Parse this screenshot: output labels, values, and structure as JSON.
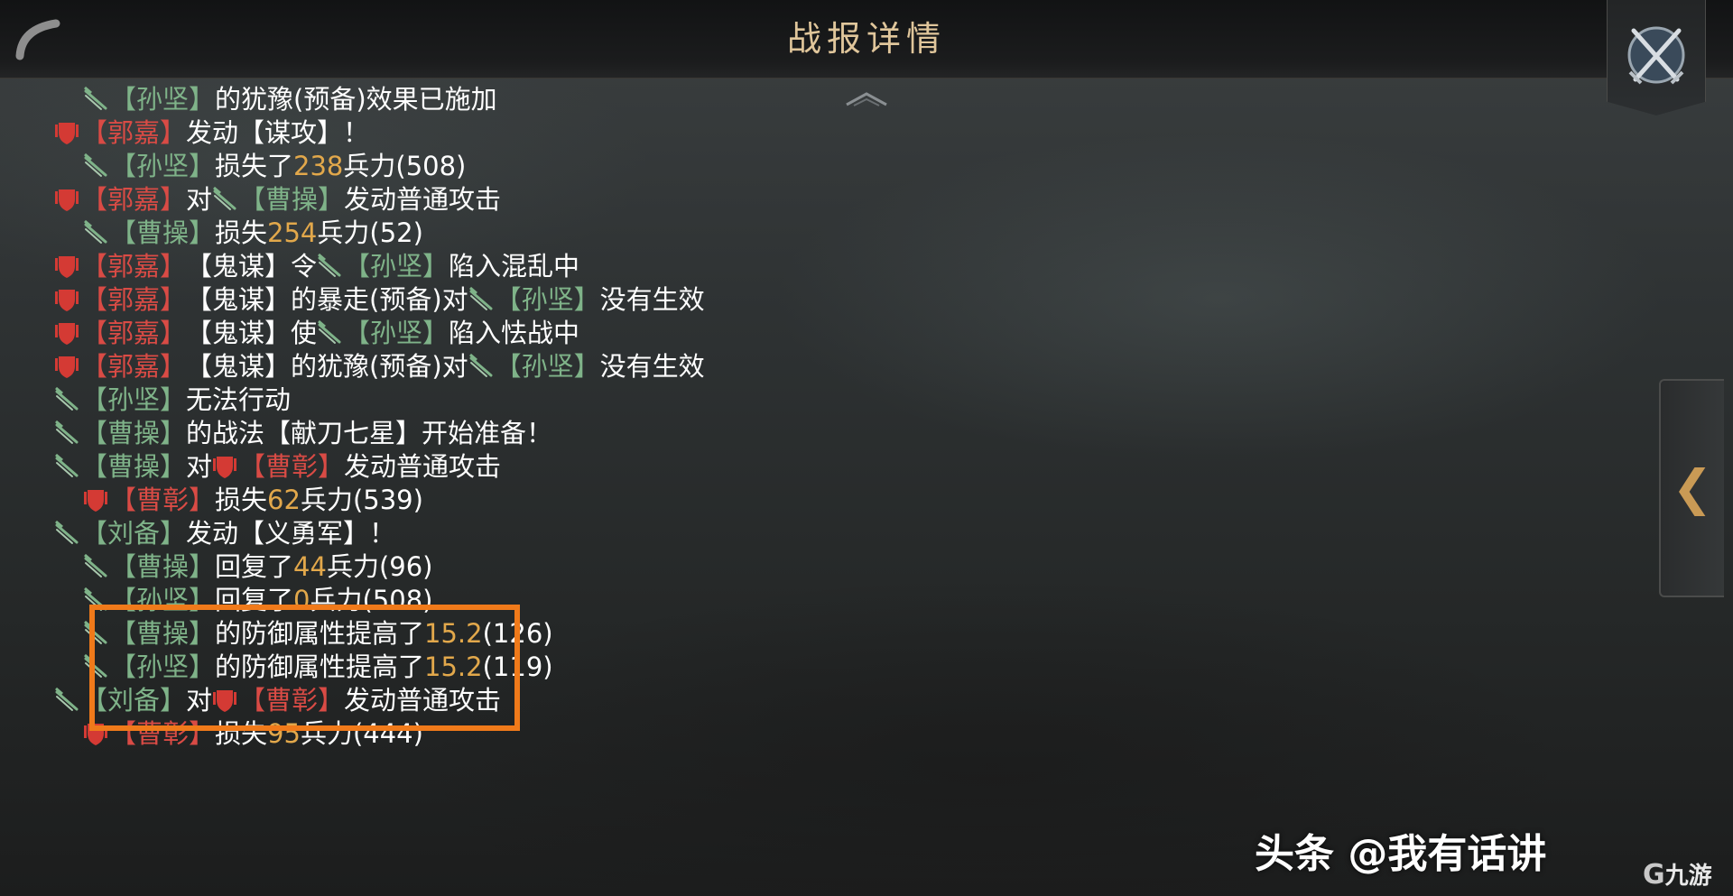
{
  "header": {
    "title": "战报详情"
  },
  "colors": {
    "ally": "#7fb389",
    "enemy": "#d94b45",
    "number": "#e2a84b",
    "title": "#e0c69b",
    "highlight": "#f07a1a"
  },
  "log": [
    {
      "indent": 1,
      "icon": "sword-icon",
      "parts": [
        {
          "t": "【孙坚】",
          "c": "g"
        },
        {
          "t": "的犹豫(预备)效果已施加",
          "c": "w"
        }
      ]
    },
    {
      "indent": 0,
      "icon": "shield-icon",
      "parts": [
        {
          "t": "【郭嘉】",
          "c": "r"
        },
        {
          "t": "发动【谋攻】！",
          "c": "w"
        }
      ]
    },
    {
      "indent": 1,
      "icon": "sword-icon",
      "parts": [
        {
          "t": "【孙坚】",
          "c": "g"
        },
        {
          "t": "损失了",
          "c": "w"
        },
        {
          "t": "238",
          "c": "n"
        },
        {
          "t": "兵力(508)",
          "c": "w"
        }
      ]
    },
    {
      "indent": 0,
      "icon": "shield-icon",
      "parts": [
        {
          "t": "【郭嘉】",
          "c": "r"
        },
        {
          "t": "对",
          "c": "w"
        },
        {
          "icon": "sword-icon"
        },
        {
          "t": "【曹操】",
          "c": "g"
        },
        {
          "t": "发动普通攻击",
          "c": "w"
        }
      ]
    },
    {
      "indent": 1,
      "icon": "sword-icon",
      "parts": [
        {
          "t": "【曹操】",
          "c": "g"
        },
        {
          "t": "损失",
          "c": "w"
        },
        {
          "t": "254",
          "c": "n"
        },
        {
          "t": "兵力(52)",
          "c": "w"
        }
      ]
    },
    {
      "indent": 0,
      "icon": "shield-icon",
      "parts": [
        {
          "t": "【郭嘉】",
          "c": "r"
        },
        {
          "t": "【鬼谋】令",
          "c": "w"
        },
        {
          "icon": "sword-icon"
        },
        {
          "t": "【孙坚】",
          "c": "g"
        },
        {
          "t": "陷入混乱中",
          "c": "w"
        }
      ]
    },
    {
      "indent": 0,
      "icon": "shield-icon",
      "parts": [
        {
          "t": "【郭嘉】",
          "c": "r"
        },
        {
          "t": "【鬼谋】的暴走(预备)对",
          "c": "w"
        },
        {
          "icon": "sword-icon"
        },
        {
          "t": "【孙坚】",
          "c": "g"
        },
        {
          "t": "没有生效",
          "c": "w"
        }
      ]
    },
    {
      "indent": 0,
      "icon": "shield-icon",
      "parts": [
        {
          "t": "【郭嘉】",
          "c": "r"
        },
        {
          "t": "【鬼谋】使",
          "c": "w"
        },
        {
          "icon": "sword-icon"
        },
        {
          "t": "【孙坚】",
          "c": "g"
        },
        {
          "t": "陷入怯战中",
          "c": "w"
        }
      ]
    },
    {
      "indent": 0,
      "icon": "shield-icon",
      "parts": [
        {
          "t": "【郭嘉】",
          "c": "r"
        },
        {
          "t": "【鬼谋】的犹豫(预备)对",
          "c": "w"
        },
        {
          "icon": "sword-icon"
        },
        {
          "t": "【孙坚】",
          "c": "g"
        },
        {
          "t": "没有生效",
          "c": "w"
        }
      ]
    },
    {
      "indent": 0,
      "icon": "sword-icon",
      "parts": [
        {
          "t": "【孙坚】",
          "c": "g"
        },
        {
          "t": "无法行动",
          "c": "w"
        }
      ]
    },
    {
      "indent": 0,
      "icon": "sword-icon",
      "parts": [
        {
          "t": "【曹操】",
          "c": "g"
        },
        {
          "t": "的战法【献刀七星】开始准备！",
          "c": "w"
        }
      ]
    },
    {
      "indent": 0,
      "icon": "sword-icon",
      "parts": [
        {
          "t": "【曹操】",
          "c": "g"
        },
        {
          "t": "对",
          "c": "w"
        },
        {
          "icon": "shield-icon"
        },
        {
          "t": "【曹彰】",
          "c": "r"
        },
        {
          "t": "发动普通攻击",
          "c": "w"
        }
      ]
    },
    {
      "indent": 1,
      "icon": "shield-icon",
      "parts": [
        {
          "t": "【曹彰】",
          "c": "r"
        },
        {
          "t": "损失",
          "c": "w"
        },
        {
          "t": "62",
          "c": "n"
        },
        {
          "t": "兵力(539)",
          "c": "w"
        }
      ]
    },
    {
      "indent": 0,
      "icon": "sword-icon",
      "parts": [
        {
          "t": "【刘备】",
          "c": "g"
        },
        {
          "t": "发动【义勇军】！",
          "c": "w"
        }
      ]
    },
    {
      "indent": 1,
      "icon": "sword-icon",
      "parts": [
        {
          "t": "【曹操】",
          "c": "g"
        },
        {
          "t": "回复了",
          "c": "w"
        },
        {
          "t": "44",
          "c": "n"
        },
        {
          "t": "兵力(96)",
          "c": "w"
        }
      ]
    },
    {
      "indent": 1,
      "icon": "sword-icon",
      "parts": [
        {
          "t": "【孙坚】",
          "c": "g"
        },
        {
          "t": "回复了",
          "c": "w"
        },
        {
          "t": "0",
          "c": "n"
        },
        {
          "t": "兵力(508)",
          "c": "w"
        }
      ]
    },
    {
      "indent": 1,
      "icon": "sword-icon",
      "parts": [
        {
          "t": "【曹操】",
          "c": "g"
        },
        {
          "t": "的防御属性提高了",
          "c": "w"
        },
        {
          "t": "15.2",
          "c": "n"
        },
        {
          "t": "(126)",
          "c": "w"
        }
      ]
    },
    {
      "indent": 1,
      "icon": "sword-icon",
      "parts": [
        {
          "t": "【孙坚】",
          "c": "g"
        },
        {
          "t": "的防御属性提高了",
          "c": "w"
        },
        {
          "t": "15.2",
          "c": "n"
        },
        {
          "t": "(119)",
          "c": "w"
        }
      ]
    },
    {
      "indent": 0,
      "icon": "sword-icon",
      "parts": [
        {
          "t": "【刘备】",
          "c": "g"
        },
        {
          "t": "对",
          "c": "w"
        },
        {
          "icon": "shield-icon"
        },
        {
          "t": "【曹彰】",
          "c": "r"
        },
        {
          "t": "发动普通攻击",
          "c": "w"
        }
      ]
    },
    {
      "indent": 1,
      "icon": "shield-icon",
      "parts": [
        {
          "t": "【曹彰】",
          "c": "r"
        },
        {
          "t": "损失",
          "c": "w"
        },
        {
          "t": "95",
          "c": "n"
        },
        {
          "t": "兵力(444)",
          "c": "w"
        }
      ]
    }
  ],
  "side_panel": {
    "chevron": "❮"
  },
  "watermark": {
    "text": "头条 @我有话讲"
  },
  "logo": {
    "mark": "G",
    "text": "九游"
  }
}
